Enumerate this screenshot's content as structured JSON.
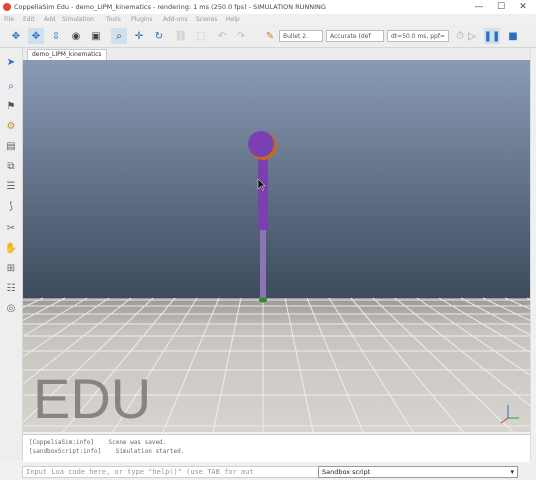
{
  "window": {
    "title": "CoppeliaSim Edu - demo_LIPM_kinematics - rendering: 1 ms (250.0 fps) - SIMULATION RUNNING",
    "minimize": "—",
    "maximize": "☐",
    "close": "✕"
  },
  "menu": [
    "File",
    "Edit",
    "Add",
    "Simulation",
    "Tools",
    "Plugins",
    "Add-ons",
    "Scenes",
    "Help"
  ],
  "toolbar": {
    "engine": "Bullet 2.",
    "accuracy": "Accurate (def",
    "timestep": "dt=50.0 ms, ppf=",
    "icons": [
      "camera-pan-icon",
      "camera-rotate-icon",
      "camera-shift-icon",
      "camera-angle-icon",
      "fit-to-view-icon",
      "click-select-icon",
      "object-shift-icon",
      "object-rotate-icon",
      "assemble-icon",
      "transfer-dna-icon",
      "undo-icon",
      "redo-icon",
      "simulation-settings-icon",
      "play-icon",
      "pause-icon",
      "stop-icon"
    ]
  },
  "scene_tab": "demo_LIPM_kinematics",
  "watermark": "EDU",
  "console": {
    "lines": [
      {
        "source": "[CoppeliaSim:info]",
        "message": "Scene was saved."
      },
      {
        "source": "[sandboxScript:info]",
        "message": "Simulation started."
      }
    ]
  },
  "command": {
    "placeholder": "Input Lua code here, or type \"help()\" (use TAB for aut",
    "script_select": "Sandbox script"
  },
  "colors": {
    "sky_top": "#8a9bb5",
    "sky_bottom": "#3c4a5c",
    "floor": "#d7d4cf",
    "robot": "#7a3fb0",
    "robot_leg": "#8c74b8",
    "accent_orange": "#c86a1e",
    "foot_green": "#2f8a2f"
  }
}
